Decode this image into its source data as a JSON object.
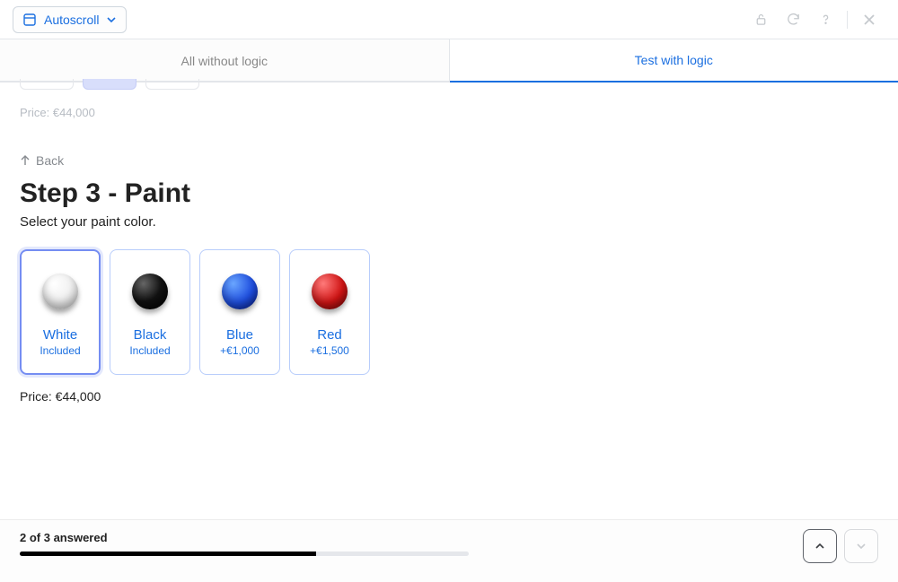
{
  "toolbar": {
    "autoscroll_label": "Autoscroll"
  },
  "tabs": {
    "left": "All without logic",
    "right": "Test with logic"
  },
  "ghost_price": "Price: €44,000",
  "back_label": "Back",
  "step": {
    "title": "Step 3 - Paint",
    "subtitle": "Select your paint color."
  },
  "options": [
    {
      "label": "White",
      "price": "Included",
      "selected": true,
      "color": "white"
    },
    {
      "label": "Black",
      "price": "Included",
      "selected": false,
      "color": "black"
    },
    {
      "label": "Blue",
      "price": "+€1,000",
      "selected": false,
      "color": "blue"
    },
    {
      "label": "Red",
      "price": "+€1,500",
      "selected": false,
      "color": "red"
    }
  ],
  "final_price": "Price: €44,000",
  "footer": {
    "answered": "2 of 3 answered",
    "progress_pct": 66
  }
}
